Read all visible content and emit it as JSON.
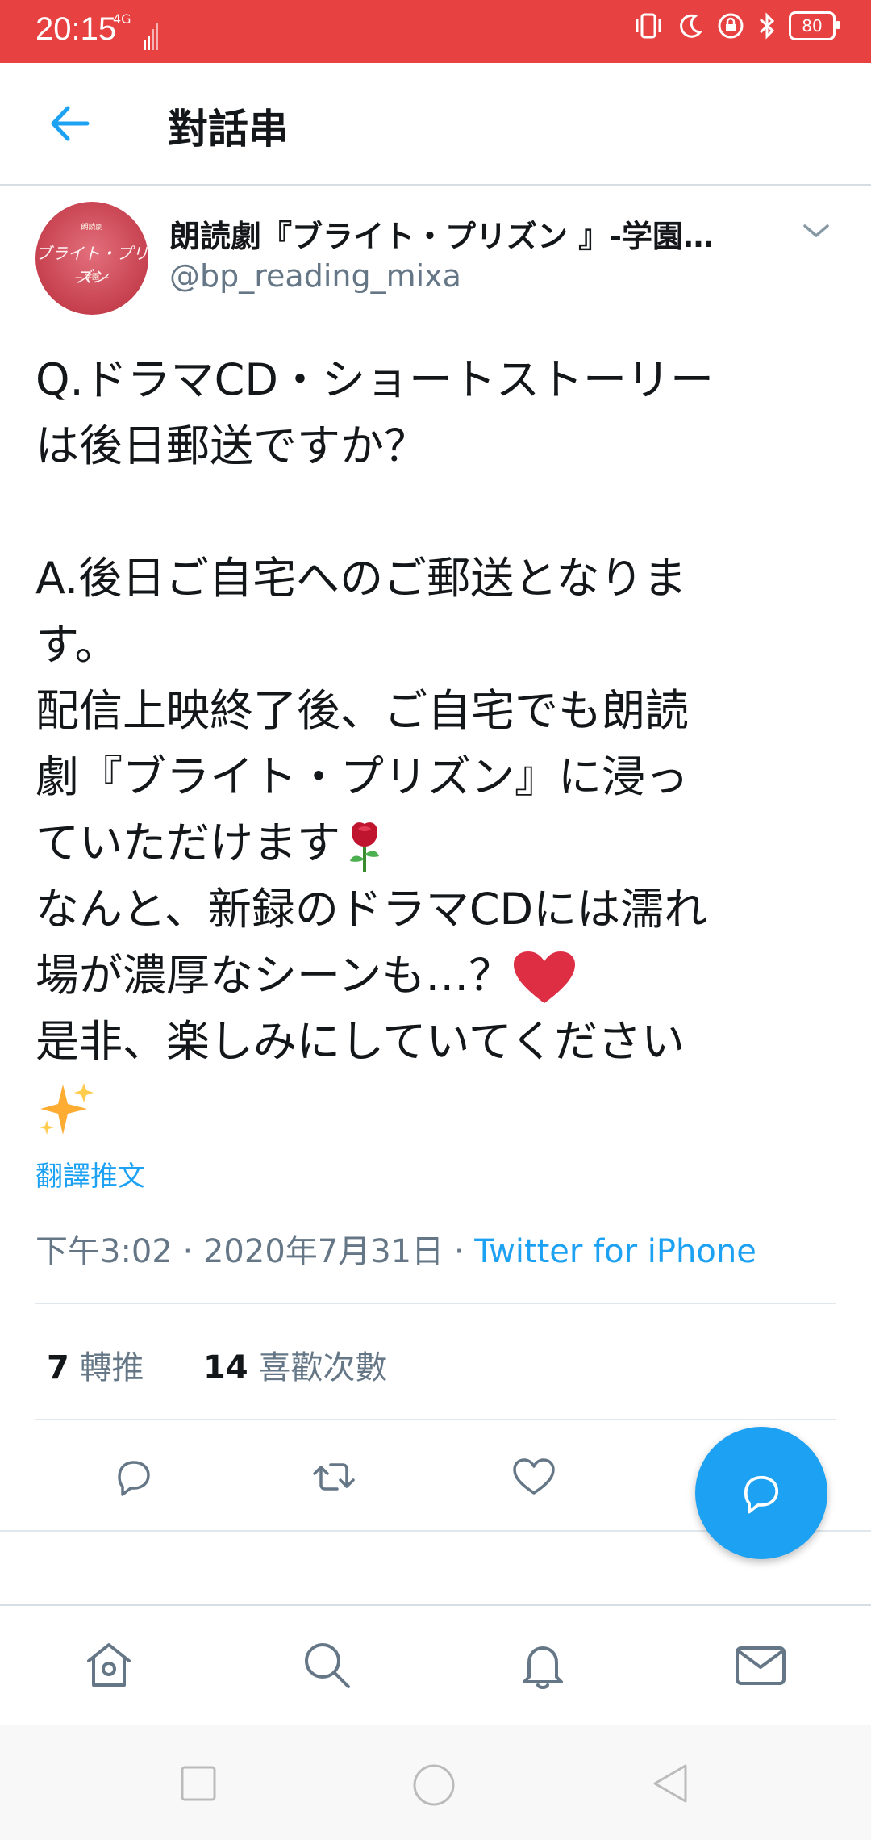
{
  "status_bar": {
    "time": "20:15",
    "network": "4G",
    "battery": "80"
  },
  "header": {
    "title": "對話串"
  },
  "tweet": {
    "display_name": "朗読劇『ブライト・プリズン 』-学園…",
    "handle": "@bp_reading_mixa",
    "avatar_text": "ブライト・プリズン",
    "body_part1": "Q.ドラマCD・ショートストーリー\nは後日郵送ですか？\n\nA.後日ご自宅へのご郵送となりま\nす。\n配信上映終了後、ご自宅でも朗読\n劇『ブライト・プリズン』に浸っ\nていただけます",
    "body_part2": "\nなんと、新録のドラマCDには濡れ\n場が濃厚なシーンも…？",
    "body_part3": "\n是非、楽しみにしていてください\n",
    "translate_label": "翻譯推文",
    "time": "下午3:02",
    "date": "2020年7月31日",
    "via": "Twitter for iPhone",
    "retweets_count": "7",
    "retweets_label": "轉推",
    "likes_count": "14",
    "likes_label": "喜歡次數"
  },
  "colors": {
    "accent": "#1da1f2",
    "status_bar": "#e84141",
    "secondary_text": "#657786"
  },
  "icons": {
    "reply": "reply-icon",
    "retweet": "retweet-icon",
    "like": "heart-icon",
    "compose_reply": "compose-reply-icon",
    "home": "home-icon",
    "search": "search-icon",
    "notifications": "bell-icon",
    "messages": "mail-icon"
  }
}
